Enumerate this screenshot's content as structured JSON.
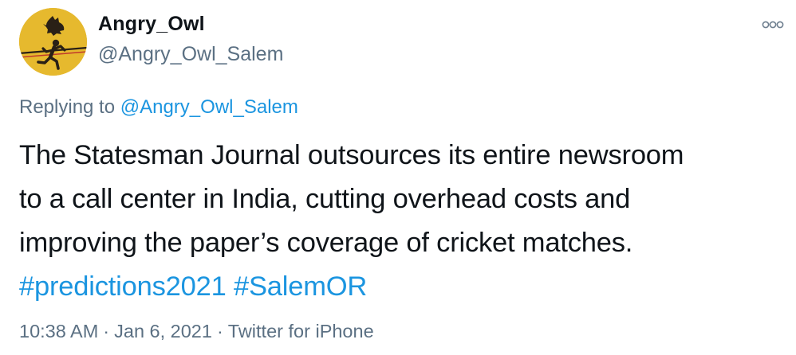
{
  "author": {
    "display_name": "Angry_Owl",
    "handle": "@Angry_Owl_Salem"
  },
  "reply": {
    "prefix": "Replying to",
    "to_handle": "@Angry_Owl_Salem"
  },
  "tweet": {
    "lines": [
      "The Statesman Journal outsources its entire newsroom",
      "to a call center in India, cutting overhead costs and",
      "improving the paper’s coverage of cricket matches."
    ],
    "hashtags": [
      "#predictions2021",
      "#SalemOR"
    ]
  },
  "meta": {
    "time": "10:38 AM",
    "separator": "·",
    "date": "Jan 6, 2021",
    "source": "Twitter for iPhone"
  },
  "colors": {
    "link": "#1b95e0",
    "secondary_text": "#5b7083",
    "avatar_bg": "#e6b92e"
  },
  "icons": {
    "more": "more-options-icon",
    "avatar": "owl-runner-avatar"
  }
}
